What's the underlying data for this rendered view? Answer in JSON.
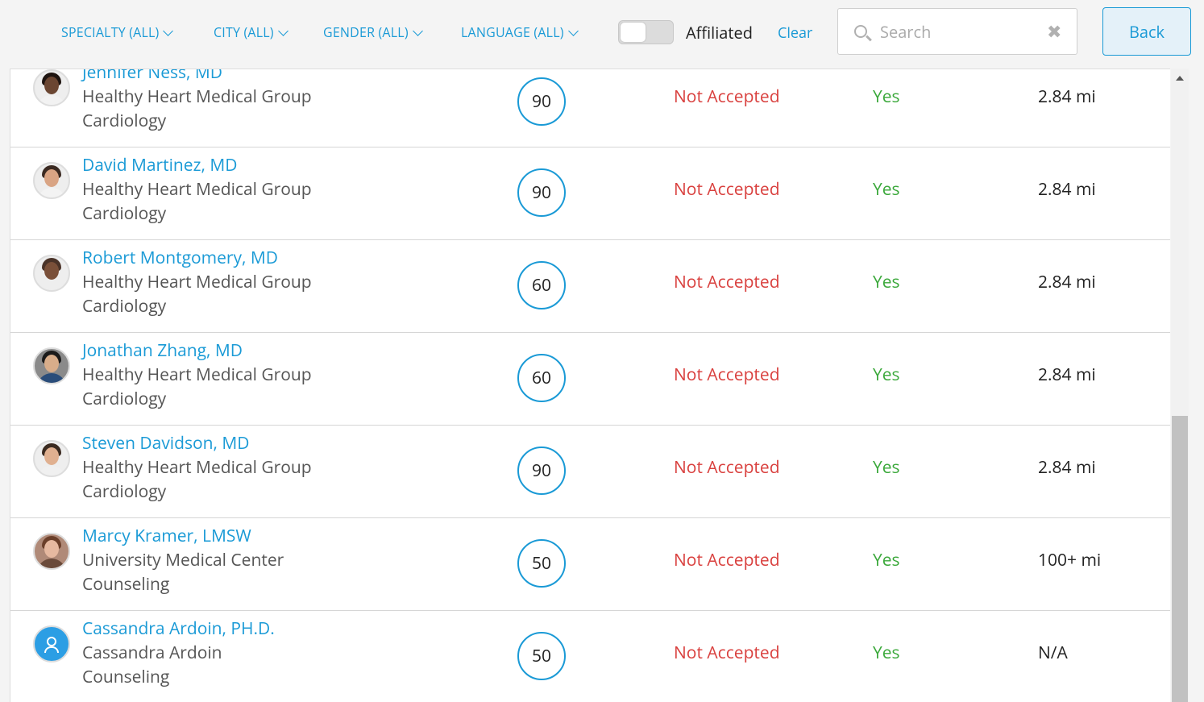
{
  "filters": {
    "specialty": "SPECIALTY (ALL)",
    "city": "CITY (ALL)",
    "gender": "GENDER (ALL)",
    "language": "LANGUAGE (ALL)"
  },
  "affiliated_label": "Affiliated",
  "clear_label": "Clear",
  "search": {
    "placeholder": "Search",
    "value": ""
  },
  "back_label": "Back",
  "providers": [
    {
      "name": "Jennifer Ness, MD",
      "org": "Healthy Heart Medical Group",
      "specialty": "Cardiology",
      "score": "90",
      "status": "Not Accepted",
      "affiliated": "Yes",
      "distance": "2.84 mi"
    },
    {
      "name": "David Martinez, MD",
      "org": "Healthy Heart Medical Group",
      "specialty": "Cardiology",
      "score": "90",
      "status": "Not Accepted",
      "affiliated": "Yes",
      "distance": "2.84 mi"
    },
    {
      "name": "Robert Montgomery, MD",
      "org": "Healthy Heart Medical Group",
      "specialty": "Cardiology",
      "score": "60",
      "status": "Not Accepted",
      "affiliated": "Yes",
      "distance": "2.84 mi"
    },
    {
      "name": "Jonathan Zhang, MD",
      "org": "Healthy Heart Medical Group",
      "specialty": "Cardiology",
      "score": "60",
      "status": "Not Accepted",
      "affiliated": "Yes",
      "distance": "2.84 mi"
    },
    {
      "name": "Steven Davidson, MD",
      "org": "Healthy Heart Medical Group",
      "specialty": "Cardiology",
      "score": "90",
      "status": "Not Accepted",
      "affiliated": "Yes",
      "distance": "2.84 mi"
    },
    {
      "name": "Marcy Kramer, LMSW",
      "org": "University Medical Center",
      "specialty": "Counseling",
      "score": "50",
      "status": "Not Accepted",
      "affiliated": "Yes",
      "distance": "100+ mi"
    },
    {
      "name": "Cassandra Ardoin, PH.D.",
      "org": "Cassandra Ardoin",
      "specialty": "Counseling",
      "score": "50",
      "status": "Not Accepted",
      "affiliated": "Yes",
      "distance": "N/A"
    }
  ],
  "colors": {
    "accent": "#1a9ad6",
    "not_accepted": "#d9403e",
    "yes": "#3aa83a",
    "generic_avatar": "#2c9ee4"
  }
}
